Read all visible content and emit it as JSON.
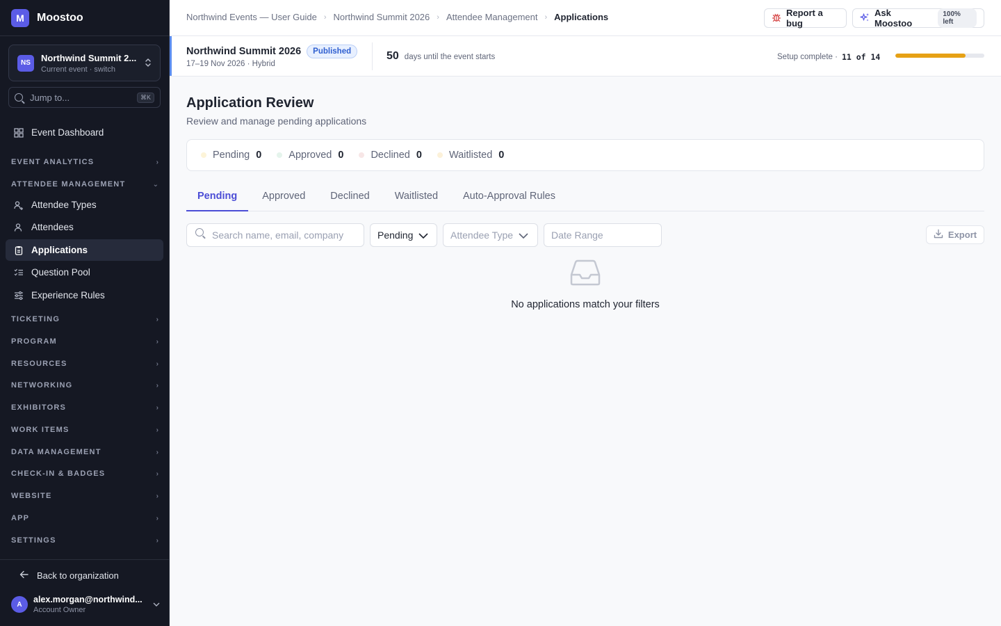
{
  "brand": {
    "logo_letter": "M",
    "name": "Moostoo"
  },
  "event_switcher": {
    "initials": "NS",
    "name": "Northwind Summit 2...",
    "subtitle": "Current event · switch"
  },
  "jump": {
    "placeholder": "Jump to...",
    "shortcut": "⌘K"
  },
  "sidebar": {
    "dashboard": "Event Dashboard",
    "sections": {
      "event_analytics": "EVENT ANALYTICS",
      "attendee_management": "ATTENDEE MANAGEMENT",
      "ticketing": "TICKETING",
      "program": "PROGRAM",
      "resources": "RESOURCES",
      "networking": "NETWORKING",
      "exhibitors": "EXHIBITORS",
      "work_items": "WORK ITEMS",
      "data_management": "DATA MANAGEMENT",
      "checkin_badges": "CHECK-IN & BADGES",
      "website": "WEBSITE",
      "app": "APP",
      "settings": "SETTINGS"
    },
    "attendee_items": {
      "attendee_types": "Attendee Types",
      "attendees": "Attendees",
      "applications": "Applications",
      "question_pool": "Question Pool",
      "experience_rules": "Experience Rules"
    },
    "back_to_org": "Back to organization",
    "user": {
      "initial": "A",
      "email": "alex.morgan@northwind...",
      "role": "Account Owner"
    }
  },
  "breadcrumbs": [
    "Northwind Events — User Guide",
    "Northwind Summit 2026",
    "Attendee Management",
    "Applications"
  ],
  "topbar": {
    "report_bug": "Report a bug",
    "ask": "Ask Moostoo",
    "ask_quota": "100% left"
  },
  "event_strip": {
    "name": "Northwind Summit 2026",
    "status": "Published",
    "date": "17–19 Nov 2026 · Hybrid",
    "days_count": "50",
    "days_text": "days until the event starts",
    "setup_label": "Setup complete ·",
    "setup_count": "11 of 14",
    "setup_fraction": 0.786
  },
  "page": {
    "title": "Application Review",
    "subtitle": "Review and manage pending applications"
  },
  "stats": [
    {
      "label": "Pending",
      "value": "0",
      "color": "#fdf4d8"
    },
    {
      "label": "Approved",
      "value": "0",
      "color": "#e5f4ec"
    },
    {
      "label": "Declined",
      "value": "0",
      "color": "#f7e6e6"
    },
    {
      "label": "Waitlisted",
      "value": "0",
      "color": "#fcf1d9"
    }
  ],
  "tabs": [
    "Pending",
    "Approved",
    "Declined",
    "Waitlisted",
    "Auto-Approval Rules"
  ],
  "filters": {
    "search_placeholder": "Search name, email, company",
    "status_value": "Pending",
    "attendee_type": "Attendee Type",
    "date_range": "Date Range",
    "export": "Export"
  },
  "empty_state": {
    "message": "No applications match your filters"
  }
}
